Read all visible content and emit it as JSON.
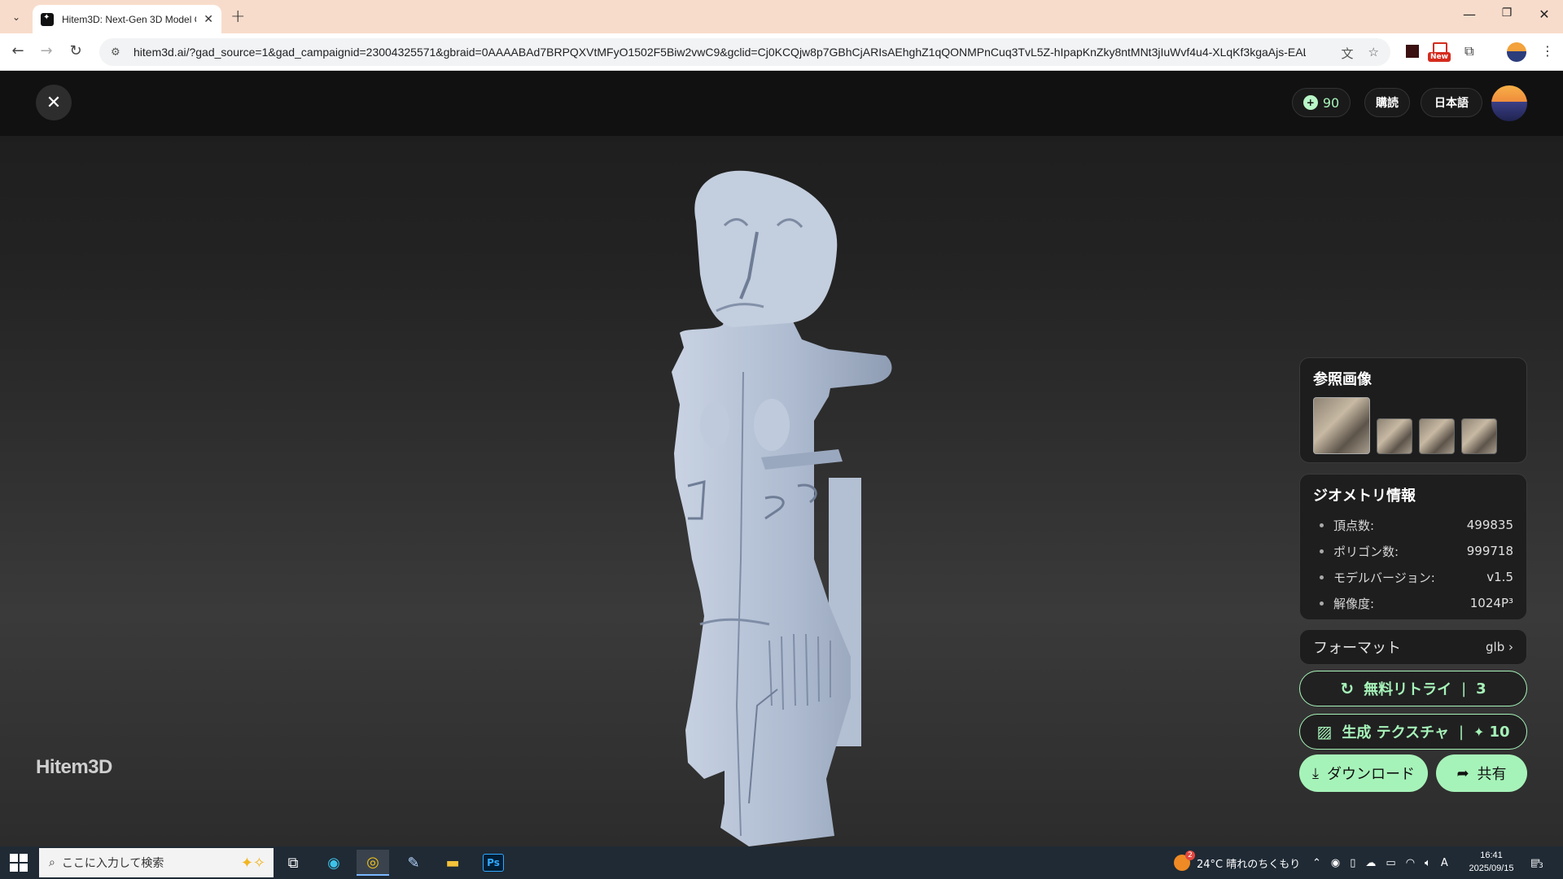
{
  "browser": {
    "tab_title": "Hitem3D: Next-Gen 3D Model G",
    "url": "hitem3d.ai/?gad_source=1&gad_campaignid=23004325571&gbraid=0AAAABAd7BRPQXVtMFyO1502F5Biw2vwC9&gclid=Cj0KCQjw8p7GBhCjARIsAEhghZ1qQONMPnCuq3TvL5Z-hIpapKnZky8ntMNt3jIuWvf4u4-XLqKf3kgaAjs-EALw_wcB",
    "ext_badge": "New"
  },
  "header": {
    "credits": "90",
    "subscribe_label": "購読",
    "language_label": "日本語"
  },
  "watermark": "Hitem3D",
  "reference": {
    "title": "参照画像"
  },
  "geometry": {
    "title": "ジオメトリ情報",
    "rows": [
      {
        "label": "頂点数:",
        "value": "499835"
      },
      {
        "label": "ポリゴン数:",
        "value": "999718"
      },
      {
        "label": "モデルバージョン:",
        "value": "v1.5"
      },
      {
        "label": "解像度:",
        "value": "1024P³"
      }
    ]
  },
  "format": {
    "label": "フォーマット",
    "value": "glb"
  },
  "actions": {
    "retry_label": "無料リトライ",
    "retry_count": "3",
    "texture_label": "生成 テクスチャ",
    "texture_cost": "10",
    "download_label": "ダウンロード",
    "share_label": "共有"
  },
  "taskbar": {
    "search_placeholder": "ここに入力して検索",
    "weather": "24°C  晴れのちくもり",
    "time": "16:41",
    "date": "2025/09/15",
    "notifications": "3",
    "weather_badge": "2"
  },
  "colors": {
    "accent": "#a6f3b9",
    "model": "#b7c3d6",
    "app_bg": "#111111"
  }
}
